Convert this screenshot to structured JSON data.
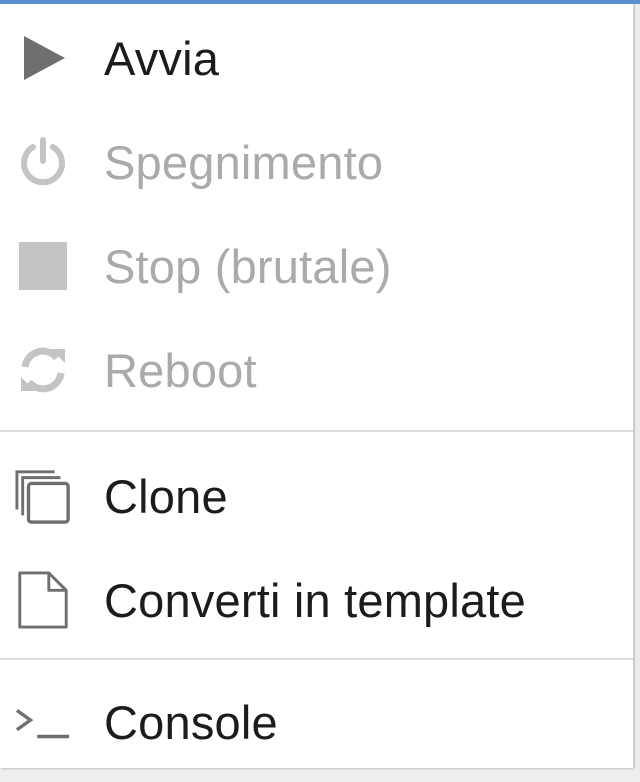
{
  "menu": {
    "items": [
      {
        "label": "Avvia",
        "icon": "play-icon",
        "enabled": true
      },
      {
        "label": "Spegnimento",
        "icon": "power-icon",
        "enabled": false
      },
      {
        "label": "Stop (brutale)",
        "icon": "stop-icon",
        "enabled": false
      },
      {
        "label": "Reboot",
        "icon": "reload-icon",
        "enabled": false
      },
      {
        "label": "Clone",
        "icon": "clone-icon",
        "enabled": true
      },
      {
        "label": "Converti in template",
        "icon": "file-icon",
        "enabled": true
      },
      {
        "label": "Console",
        "icon": "terminal-icon",
        "enabled": true
      }
    ]
  },
  "colors": {
    "enabled_text": "#1c1c1c",
    "disabled_text": "#aaaaaa",
    "enabled_icon": "#6f6f6f",
    "disabled_icon": "#c4c4c4",
    "top_accent": "#5b8fd0"
  }
}
